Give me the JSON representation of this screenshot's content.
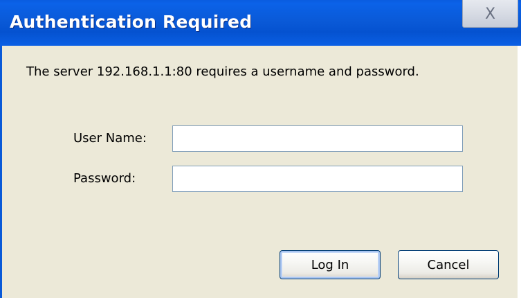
{
  "dialog": {
    "title": "Authentication Required",
    "close_glyph": "X",
    "message": "The server 192.168.1.1:80 requires a username and password.",
    "username_label": "User Name:",
    "username_value": "",
    "password_label": "Password:",
    "password_value": "",
    "login_label": "Log In",
    "cancel_label": "Cancel"
  },
  "colors": {
    "titlebar": "#0a5ad8",
    "body_background": "#ece9d8",
    "field_border": "#7f9db9",
    "button_border": "#003c74"
  },
  "icons": {
    "close": "close-icon"
  }
}
